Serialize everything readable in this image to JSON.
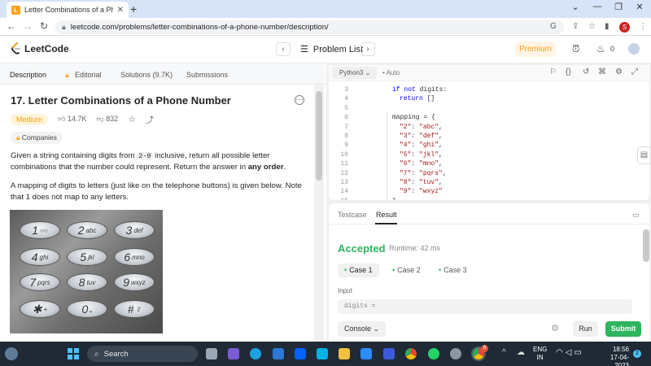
{
  "browser": {
    "tab_title": "Letter Combinations of a Phone N",
    "tab_close": "✕",
    "new_tab": "+",
    "window_controls": [
      "⌄",
      "—",
      "❐",
      "✕"
    ],
    "url": "leetcode.com/problems/letter-combinations-of-a-phone-number/description/",
    "profile_initial": "S"
  },
  "header": {
    "logo_text": "LeetCode",
    "problem_list": "Problem List",
    "premium": "Premium",
    "notification_count": "0"
  },
  "left_tabs": [
    "Description",
    "Editorial",
    "Solutions (9.7K)",
    "Submissions"
  ],
  "problem": {
    "title": "17. Letter Combinations of a Phone Number",
    "difficulty": "Medium",
    "likes": "14.7K",
    "dislikes": "832",
    "companies": "Companies",
    "desc_1a": "Given a string containing digits from ",
    "desc_1code": "2-9",
    "desc_1b": " inclusive, return all possible letter combinations that the number could represent. Return the answer in ",
    "desc_1bold": "any order",
    "desc_1end": ".",
    "desc_2": "A mapping of digits to letters (just like on the telephone buttons) is given below. Note that 1 does not map to any letters."
  },
  "keypad": [
    {
      "digit": "1",
      "letters": "○○"
    },
    {
      "digit": "2",
      "letters": "abc"
    },
    {
      "digit": "3",
      "letters": "def"
    },
    {
      "digit": "4",
      "letters": "ghi"
    },
    {
      "digit": "5",
      "letters": "jkl"
    },
    {
      "digit": "6",
      "letters": "mno"
    },
    {
      "digit": "7",
      "letters": "pqrs"
    },
    {
      "digit": "8",
      "letters": "tuv"
    },
    {
      "digit": "9",
      "letters": "wxyz"
    },
    {
      "digit": "✱",
      "letters": "+"
    },
    {
      "digit": "0",
      "letters": "⎵"
    },
    {
      "digit": "#",
      "letters": "⇧"
    }
  ],
  "editor": {
    "language": "Python3",
    "auto": "Auto",
    "lines": [
      {
        "n": "3",
        "indent": 1,
        "parts": [
          [
            "kw",
            "if not"
          ],
          [
            "punc",
            " digits:"
          ]
        ]
      },
      {
        "n": "4",
        "indent": 2,
        "parts": [
          [
            "kw",
            "return"
          ],
          [
            "punc",
            " []"
          ]
        ]
      },
      {
        "n": "5",
        "indent": 0,
        "parts": []
      },
      {
        "n": "6",
        "indent": 1,
        "parts": [
          [
            "punc",
            "mapping = {"
          ]
        ]
      },
      {
        "n": "7",
        "indent": 2,
        "parts": [
          [
            "str",
            "\"2\""
          ],
          [
            "punc",
            ": "
          ],
          [
            "str",
            "\"abc\""
          ],
          [
            "punc",
            ","
          ]
        ]
      },
      {
        "n": "8",
        "indent": 2,
        "parts": [
          [
            "str",
            "\"3\""
          ],
          [
            "punc",
            ": "
          ],
          [
            "str",
            "\"def\""
          ],
          [
            "punc",
            ","
          ]
        ]
      },
      {
        "n": "9",
        "indent": 2,
        "parts": [
          [
            "str",
            "\"4\""
          ],
          [
            "punc",
            ": "
          ],
          [
            "str",
            "\"ghi\""
          ],
          [
            "punc",
            ","
          ]
        ]
      },
      {
        "n": "10",
        "indent": 2,
        "parts": [
          [
            "str",
            "\"5\""
          ],
          [
            "punc",
            ": "
          ],
          [
            "str",
            "\"jkl\""
          ],
          [
            "punc",
            ","
          ]
        ]
      },
      {
        "n": "11",
        "indent": 2,
        "parts": [
          [
            "str",
            "\"6\""
          ],
          [
            "punc",
            ": "
          ],
          [
            "str",
            "\"mno\""
          ],
          [
            "punc",
            ","
          ]
        ]
      },
      {
        "n": "12",
        "indent": 2,
        "parts": [
          [
            "str",
            "\"7\""
          ],
          [
            "punc",
            ": "
          ],
          [
            "str",
            "\"pqrs\""
          ],
          [
            "punc",
            ","
          ]
        ]
      },
      {
        "n": "13",
        "indent": 2,
        "parts": [
          [
            "str",
            "\"8\""
          ],
          [
            "punc",
            ": "
          ],
          [
            "str",
            "\"tuv\""
          ],
          [
            "punc",
            ","
          ]
        ]
      },
      {
        "n": "14",
        "indent": 2,
        "parts": [
          [
            "str",
            "\"9\""
          ],
          [
            "punc",
            ": "
          ],
          [
            "str",
            "\"wxyz\""
          ]
        ]
      },
      {
        "n": "15",
        "indent": 1,
        "parts": [
          [
            "punc",
            "}"
          ]
        ]
      }
    ]
  },
  "result": {
    "tabs": [
      "Testcase",
      "Result"
    ],
    "status": "Accepted",
    "runtime": "Runtime: 42 ms",
    "cases": [
      "Case 1",
      "Case 2",
      "Case 3"
    ],
    "input_label": "Input",
    "input_value": "digits ="
  },
  "actions": {
    "console": "Console",
    "run": "Run",
    "submit": "Submit"
  },
  "taskbar": {
    "search": "Search",
    "lang_line1": "ENG",
    "lang_line2": "IN",
    "time": "18:56",
    "date": "17-04-2023",
    "notif_count": "2",
    "chrome_badge": "8"
  },
  "colors": {
    "accent": "#ffa116",
    "accepted": "#2db55d",
    "submit": "#2db55d"
  }
}
